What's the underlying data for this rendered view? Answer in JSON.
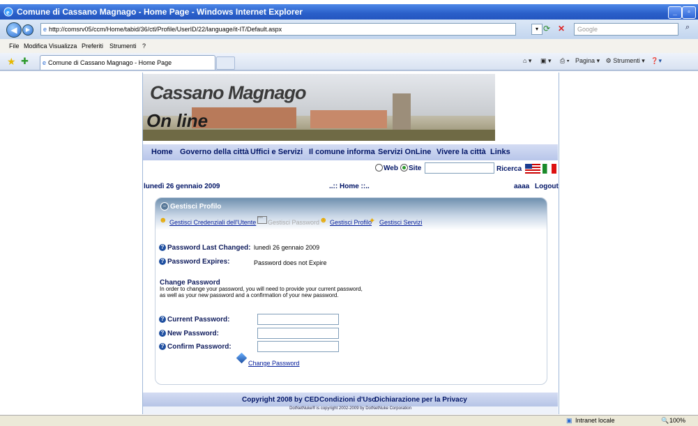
{
  "window": {
    "title": "Comune di Cassano Magnago - Home Page - Windows Internet Explorer"
  },
  "address": {
    "url": "http://comsrv05/ccm/Home/tabid/36/ctl/Profile/UserID/22/language/it-IT/Default.aspx",
    "search_placeholder": "Google"
  },
  "menu": {
    "items": [
      "File",
      "Modifica",
      "Visualizza",
      "Preferiti",
      "Strumenti",
      "?"
    ]
  },
  "tabs": {
    "active": "Comune di Cassano Magnago - Home Page"
  },
  "cmdbar": {
    "page": "Pagina",
    "tools": "Strumenti"
  },
  "site": {
    "brand_line1": "Cassano Magnago",
    "brand_line2": "On line",
    "nav": [
      "Home",
      "Governo della città",
      "Uffici e Servizi",
      "Il comune informa",
      "Servizi OnLine",
      "Vivere la città",
      "Links"
    ],
    "search": {
      "opt_web": "Web",
      "opt_site": "Site",
      "button": "Ricerca"
    },
    "date": "lunedì 26 gennaio 2009",
    "breadcrumb": "..:: Home ::..",
    "user": "aaaa",
    "logout": "Logout"
  },
  "panel": {
    "title": "Gestisci Profilo",
    "links": {
      "credentials": "Gestisci Credenziali dell'Utente",
      "password": "Gestisci Password",
      "profile": "Gestisci Profilo",
      "services": "Gestisci Servizi"
    },
    "last_changed_label": "Password Last Changed:",
    "last_changed_value": "lunedì 26 gennaio 2009",
    "expires_label": "Password Expires:",
    "expires_value": "Password does not Expire",
    "change_heading": "Change Password",
    "change_text": "In order to change your password, you will need to provide your current password, as well as your new password and a confirmation of your new password.",
    "current_label": "Current Password:",
    "new_label": "New Password:",
    "confirm_label": "Confirm Password:",
    "change_link": "Change Password"
  },
  "footer": {
    "copyright": "Copyright 2008 by CED",
    "terms": "Condizioni d'Uso",
    "privacy": "Dichiarazione per la Privacy",
    "dnn": "DotNetNuke® is copyright 2002-2009 by DotNetNuke Corporation"
  },
  "status": {
    "zone": "Intranet locale",
    "zoom": "100%"
  }
}
